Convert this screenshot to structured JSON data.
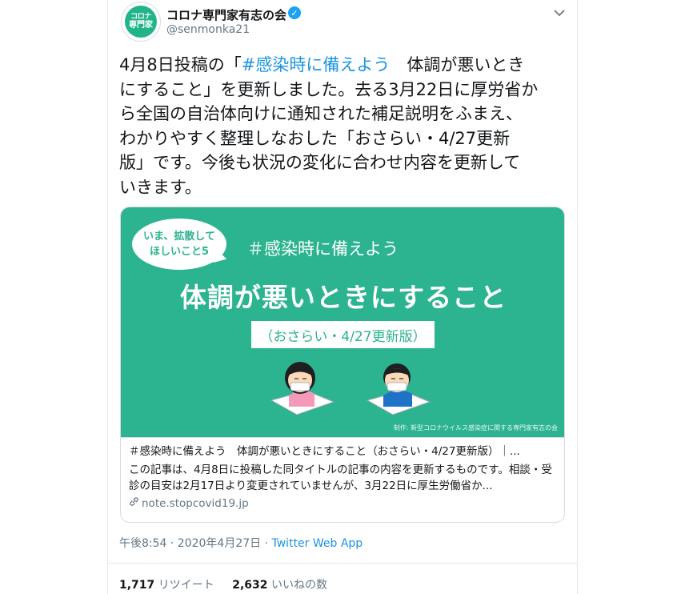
{
  "account": {
    "avatar_line1": "コロナ",
    "avatar_line2": "専門家",
    "display_name": "コロナ専門家有志の会",
    "handle": "@senmonka21",
    "verified_mark": "✓"
  },
  "tweet": {
    "text_before": "4月8日投稿の「",
    "hashtag": "#感染時に備えよう",
    "text_after": "　体調が悪いとき\nにすること」を更新しました。去る3月22日に厚労省か\nら全国の自治体向けに通知された補足説明をふまえ、\nわかりやすく整理しなおした「おさらい・4/27更新\n版」です。今後も状況の変化に合わせ内容を更新して\nいきます。"
  },
  "card": {
    "image": {
      "bubble_line1": "いま、拡散して",
      "bubble_line2": "ほしいこと5",
      "hashtag": "＃感染時に備えよう",
      "title": "体調が悪いときにすること",
      "subtitle": "（おさらい・4/27更新版）",
      "credit": "制作: 新型コロナウイルス感染症に関する専門家有志の会"
    },
    "title": "＃感染時に備えよう　体調が悪いときにすること（おさらい・4/27更新版）｜...",
    "description": "この記事は、4月8日に投稿した同タイトルの記事の内容を更新するものです。相談・受診の目安は2月17日より変更されていませんが、3月22日に厚生労働省か...",
    "domain": "note.stopcovid19.jp"
  },
  "meta": {
    "timestamp": "午後8:54 · 2020年4月27日 · ",
    "app": "Twitter Web App"
  },
  "stats": {
    "retweets": "1,717",
    "retweets_label": "リツイート",
    "likes": "2,632",
    "likes_label": "いいねの数"
  },
  "colors": {
    "card_green": "#2cb390",
    "link_blue": "#1b95e0",
    "verified_blue": "#1da1f2"
  },
  "icons": [
    "verified-icon",
    "chevron-down-icon",
    "link-icon"
  ]
}
